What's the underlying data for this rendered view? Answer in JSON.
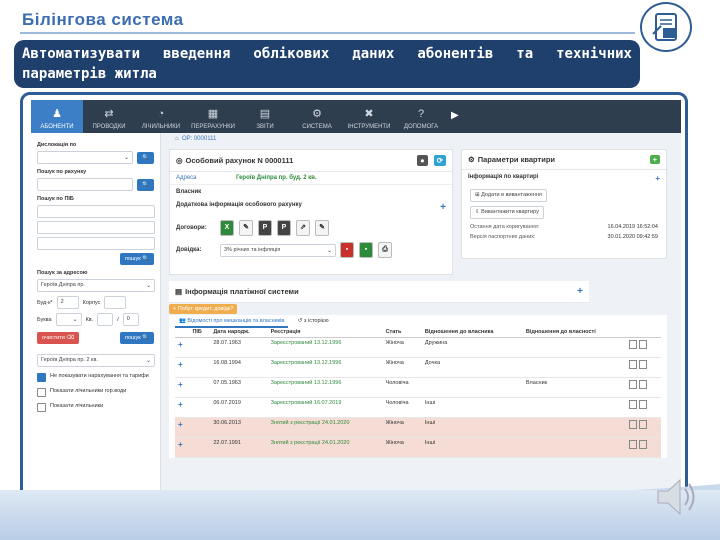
{
  "slide": {
    "title": "Білінгова система",
    "banner": "Автоматизувати введення облікових даних абонентів та технічних параметрів житла"
  },
  "nav": [
    {
      "label": "АБОНЕНТИ",
      "icon": "users-icon",
      "active": true
    },
    {
      "label": "ПРОВОДКИ",
      "icon": "sync-icon"
    },
    {
      "label": "ЛІЧИЛЬНИКИ",
      "icon": "gauge-icon"
    },
    {
      "label": "ПЕРЕРАХУНКИ",
      "icon": "calculator-icon"
    },
    {
      "label": "ЗВІТИ",
      "icon": "report-icon"
    },
    {
      "label": "СИСТЕМА",
      "icon": "gear-icon"
    },
    {
      "label": "ІНСТРУМЕНТИ",
      "icon": "tools-icon"
    },
    {
      "label": "ДОПОМОГА",
      "icon": "help-icon"
    }
  ],
  "sidebar": {
    "dislocation_label": "Дислокація по",
    "account_search_label": "Пошук по рахунку",
    "name_search_label": "Пошук по ПІБ",
    "address_search_label": "Пошук за адресою",
    "street_value": "Героїв Дніпра пр.",
    "building_label": "Буд-к*",
    "building_value": "2",
    "corpus_label": "Корпус",
    "letter_label": "Буква",
    "apt_label": "Кв.",
    "apt_value": "0",
    "search_btn": "пошук",
    "clear_btn": "очистити",
    "address_value": "Героїв Дніпра пр. 2 кв.",
    "chk1": "Не показувати нарахування та тарифи",
    "chk2": "Показати лічильники гор.води",
    "chk3": "Показати лічильники"
  },
  "breadcrumb": "ОР: 0000111",
  "account": {
    "title": "Особовий рахунок N 0000111",
    "address_label": "Адреса",
    "address_value": "Героїв Дніпра пр. буд. 2 кв.",
    "owner_label": "Власник",
    "extra_label": "Додаткова інформація особового рахунку",
    "contracts_label": "Договори:",
    "reference_label": "Довідка:",
    "reference_value": "3% річних та інфляція"
  },
  "apartment": {
    "title": "Параметри квартири",
    "info_label": "Інформація по квартирі",
    "add_btn": "Додати в вивантаження",
    "export_btn": "Вивантажити квартиру",
    "last_edit_label": "Остання дата коригування:",
    "last_edit_value": "16.04.2019 16:52:04",
    "passport_label": "Версія паспортних даних:",
    "passport_value": "30.01.2020 09:42:59"
  },
  "payer": {
    "title": "Інформація платіжної системи",
    "note_btn": "+ Побут кредит. довідк?",
    "tab1": "Відомості про мешканців та власників",
    "tab2": "з історією",
    "columns": [
      "ПІБ",
      "Дата народж.",
      "Реєстрація",
      "Стать",
      "Відношення до власника",
      "Відношення до власності"
    ],
    "rows": [
      {
        "dob": "28.07.1963",
        "reg": "Зареєстрований 13.12.1996",
        "sex": "Жіноча",
        "rel": "Дружина",
        "prop": "",
        "pink": false
      },
      {
        "dob": "16.08.1994",
        "reg": "Зареєстрований 13.12.1996",
        "sex": "Жіноча",
        "rel": "Дочка",
        "prop": "",
        "pink": false
      },
      {
        "dob": "07.05.1963",
        "reg": "Зареєстрований 13.12.1996",
        "sex": "Чоловіча",
        "rel": "",
        "prop": "Власник",
        "pink": false
      },
      {
        "dob": "06.07.2019",
        "reg": "Зареєстрований 16.07.2019",
        "sex": "Чоловіча",
        "rel": "Інші",
        "prop": "",
        "pink": false
      },
      {
        "dob": "30.06.2013",
        "reg": "Знятий з реєстрації 24.01.2020",
        "sex": "Жіноча",
        "rel": "Інші",
        "prop": "",
        "pink": true
      },
      {
        "dob": "22.07.1991",
        "reg": "Знятий з реєстрації 24.01.2020",
        "sex": "Жіноча",
        "rel": "Інші",
        "prop": "",
        "pink": true
      }
    ]
  }
}
